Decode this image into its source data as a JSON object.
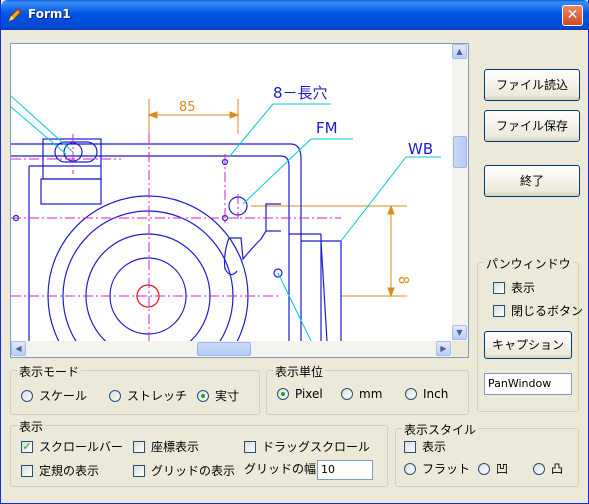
{
  "window": {
    "title": "Form1",
    "close_glyph": "✕"
  },
  "buttons": {
    "load": "ファイル読込",
    "save": "ファイル保存",
    "exit": "終了",
    "caption": "キャプション"
  },
  "drawing": {
    "label_8_slot": "8－長穴",
    "label_85": "85",
    "label_fm": "FM",
    "label_wb": "WB",
    "label_8": "8"
  },
  "pan_window": {
    "title": "パンウィンドウ",
    "show_label": "表示",
    "close_button_label": "閉じるボタン",
    "show_checked": false,
    "close_button_checked": false,
    "caption_value": "PanWindow"
  },
  "display_mode": {
    "title": "表示モード",
    "options": [
      "スケール",
      "ストレッチ",
      "実寸"
    ],
    "selected": "実寸"
  },
  "display_unit": {
    "title": "表示単位",
    "options": [
      "Pixel",
      "mm",
      "Inch"
    ],
    "selected": "Pixel"
  },
  "display": {
    "title": "表示",
    "scrollbar_label": "スクロールバー",
    "coords_label": "座標表示",
    "drag_scroll_label": "ドラッグスクロール",
    "regular_label": "定規の表示",
    "grid_label": "グリッドの表示",
    "grid_width_label": "グリッドの幅",
    "grid_width_value": "10",
    "scrollbar_checked": true,
    "coords_checked": false,
    "drag_scroll_checked": false,
    "regular_checked": false,
    "grid_checked": false
  },
  "display_style": {
    "title": "表示スタイル",
    "show_label": "表示",
    "show_checked": false,
    "options": [
      "フラット",
      "凹",
      "凸"
    ]
  },
  "icons": {
    "app": "pencil-icon",
    "close": "close-icon",
    "scroll_up": "▲",
    "scroll_down": "▼",
    "scroll_left": "◀",
    "scroll_right": "▶",
    "check_mark": "✓"
  }
}
